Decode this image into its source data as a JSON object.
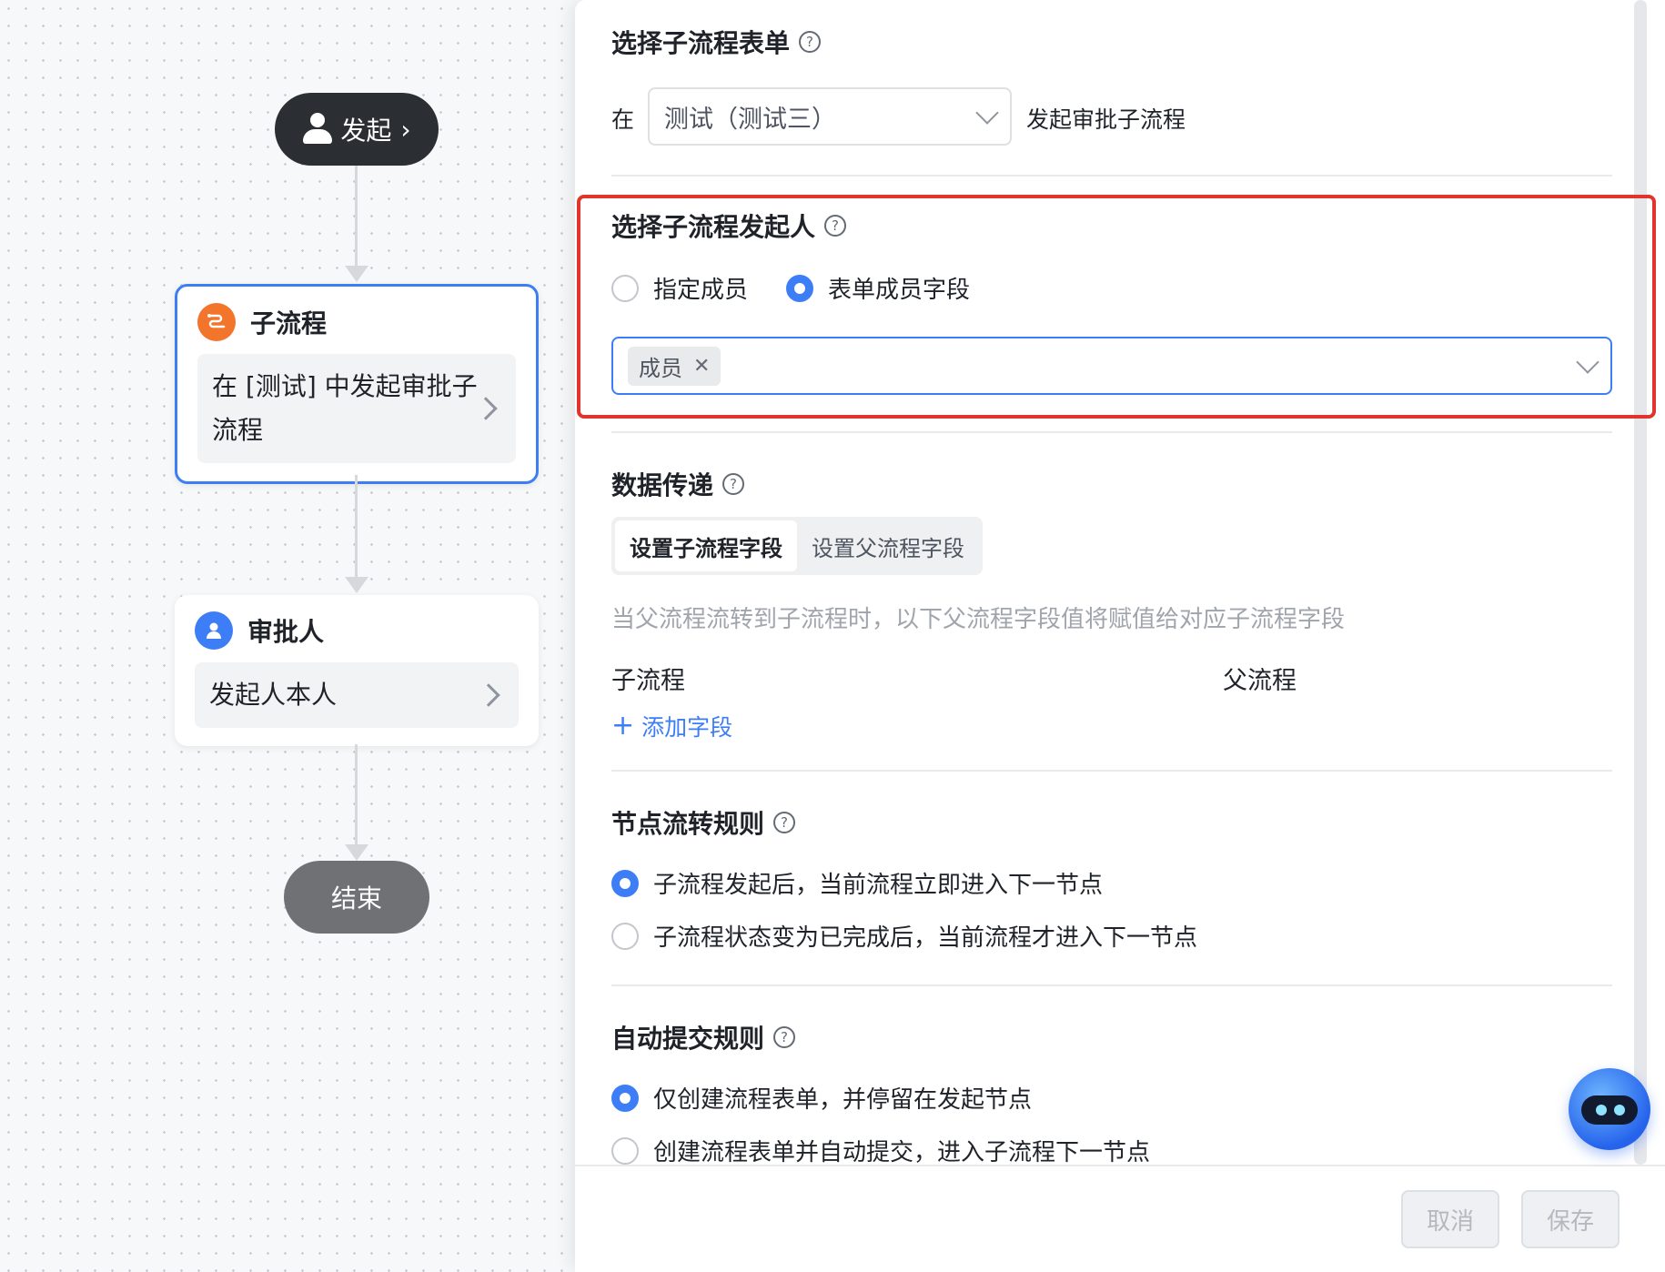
{
  "flow": {
    "start_label": "发起",
    "subprocess_node": {
      "title": "子流程",
      "body": "在 [测试] 中发起审批子流程"
    },
    "approver_node": {
      "title": "审批人",
      "body": "发起人本人"
    },
    "end_label": "结束"
  },
  "panel": {
    "form_section": {
      "title": "选择子流程表单",
      "prefix": "在",
      "selected_form": "测试（测试三）",
      "suffix": "发起审批子流程"
    },
    "initiator_section": {
      "title": "选择子流程发起人",
      "options": [
        {
          "label": "指定成员",
          "checked": false
        },
        {
          "label": "表单成员字段",
          "checked": true
        }
      ],
      "selected_tag": "成员"
    },
    "data_section": {
      "title": "数据传递",
      "tabs": [
        {
          "label": "设置子流程字段",
          "active": true
        },
        {
          "label": "设置父流程字段",
          "active": false
        }
      ],
      "hint": "当父流程流转到子流程时，以下父流程字段值将赋值给对应子流程字段",
      "col_child": "子流程",
      "col_parent": "父流程",
      "add_link": "添加字段"
    },
    "node_rule_section": {
      "title": "节点流转规则",
      "options": [
        {
          "label": "子流程发起后，当前流程立即进入下一节点",
          "checked": true
        },
        {
          "label": "子流程状态变为已完成后，当前流程才进入下一节点",
          "checked": false
        }
      ]
    },
    "auto_submit_section": {
      "title": "自动提交规则",
      "options": [
        {
          "label": "仅创建流程表单，并停留在发起节点",
          "checked": true
        },
        {
          "label": "创建流程表单并自动提交，进入子流程下一节点",
          "checked": false
        }
      ]
    },
    "footer": {
      "cancel_label": "取消",
      "save_label": "保存"
    }
  },
  "colors": {
    "accent": "#3d7ef6",
    "highlight": "#e0342d",
    "subprocess_icon": "#f3742b"
  }
}
